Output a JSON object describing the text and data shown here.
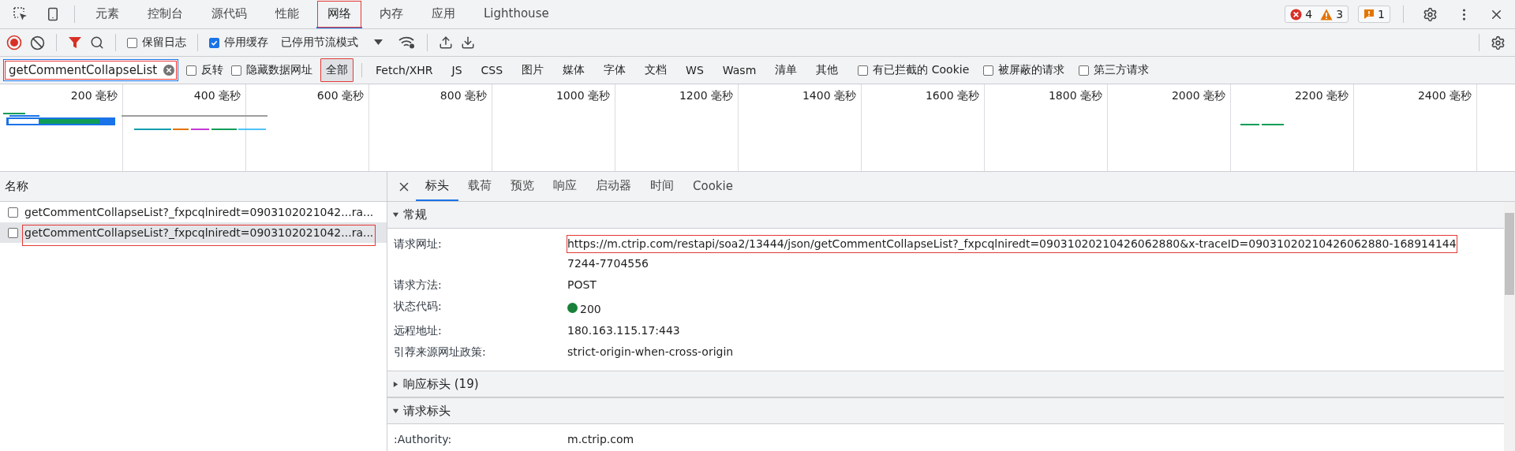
{
  "main_tabs": [
    {
      "label": "元素",
      "selected": false,
      "marked": false
    },
    {
      "label": "控制台",
      "selected": false,
      "marked": false
    },
    {
      "label": "源代码",
      "selected": false,
      "marked": false
    },
    {
      "label": "性能",
      "selected": false,
      "marked": false
    },
    {
      "label": "网络",
      "selected": true,
      "marked": true
    },
    {
      "label": "内存",
      "selected": false,
      "marked": false
    },
    {
      "label": "应用",
      "selected": false,
      "marked": false
    },
    {
      "label": "Lighthouse",
      "selected": false,
      "marked": false
    }
  ],
  "issue_counters": {
    "errors": "4",
    "warnings": "3",
    "issues": "1"
  },
  "toolbar": {
    "recording": true,
    "checkboxes": [
      {
        "label": "保留日志",
        "checked": false
      },
      {
        "label": "停用缓存",
        "checked": true
      }
    ],
    "throttle": "已停用节流模式"
  },
  "filter": {
    "value": "getCommentCollapseList",
    "marked": true,
    "checkboxes_before": [
      {
        "label": "反转",
        "checked": false
      },
      {
        "label": "隐藏数据网址",
        "checked": false
      }
    ],
    "types": [
      {
        "label": "全部",
        "selected": true,
        "marked": true
      },
      {
        "label": "Fetch/XHR",
        "selected": false,
        "marked": false
      },
      {
        "label": "JS",
        "selected": false,
        "marked": false
      },
      {
        "label": "CSS",
        "selected": false,
        "marked": false
      },
      {
        "label": "图片",
        "selected": false,
        "marked": false
      },
      {
        "label": "媒体",
        "selected": false,
        "marked": false
      },
      {
        "label": "字体",
        "selected": false,
        "marked": false
      },
      {
        "label": "文档",
        "selected": false,
        "marked": false
      },
      {
        "label": "WS",
        "selected": false,
        "marked": false
      },
      {
        "label": "Wasm",
        "selected": false,
        "marked": false
      },
      {
        "label": "清单",
        "selected": false,
        "marked": false
      },
      {
        "label": "其他",
        "selected": false,
        "marked": false
      }
    ],
    "checkboxes_after": [
      {
        "label": "有已拦截的 Cookie",
        "checked": false
      },
      {
        "label": "被屏蔽的请求",
        "checked": false
      },
      {
        "label": "第三方请求",
        "checked": false
      }
    ]
  },
  "timeline": {
    "ticks": [
      "200 毫秒",
      "400 毫秒",
      "600 毫秒",
      "800 毫秒",
      "1000 毫秒",
      "1200 毫秒",
      "1400 毫秒",
      "1600 毫秒",
      "1800 毫秒",
      "2000 毫秒",
      "2200 毫秒",
      "2400 毫秒"
    ]
  },
  "request_list": {
    "header": "名称",
    "rows": [
      {
        "name": "getCommentCollapseList?_fxpcqlniredt=0903102021042...ra...",
        "checked": false,
        "selected": false,
        "marked": false
      },
      {
        "name": "getCommentCollapseList?_fxpcqlniredt=0903102021042...ra...",
        "checked": false,
        "selected": true,
        "marked": true
      }
    ]
  },
  "details": {
    "tabs": [
      {
        "label": "标头",
        "selected": true
      },
      {
        "label": "载荷",
        "selected": false
      },
      {
        "label": "预览",
        "selected": false
      },
      {
        "label": "响应",
        "selected": false
      },
      {
        "label": "启动器",
        "selected": false
      },
      {
        "label": "时间",
        "selected": false
      },
      {
        "label": "Cookie",
        "selected": false
      }
    ],
    "sections": [
      {
        "title": "常规",
        "expanded": true,
        "rows": [
          {
            "kind": "text",
            "label": "请求网址:",
            "value": "https://m.ctrip.com/restapi/soa2/13444/json/getCommentCollapseList?_fxpcqlniredt=09031020210426062880&x-traceID=09031020210426062880-168914144",
            "value_more": "7244-7704556",
            "marked": true
          },
          {
            "kind": "text",
            "label": "请求方法:",
            "value": "POST",
            "marked": false
          },
          {
            "kind": "status",
            "label": "状态代码:",
            "value": "200",
            "marked": false
          },
          {
            "kind": "text",
            "label": "远程地址:",
            "value": "180.163.115.17:443",
            "marked": false
          },
          {
            "kind": "text",
            "label": "引荐来源网址政策:",
            "value": "strict-origin-when-cross-origin",
            "marked": false
          }
        ]
      },
      {
        "title": "响应标头 (19)",
        "expanded": false
      },
      {
        "title": "请求标头",
        "expanded": true,
        "rows": [
          {
            "kind": "text",
            "label": ":Authority:",
            "value": "m.ctrip.com",
            "marked": false
          }
        ]
      }
    ]
  }
}
